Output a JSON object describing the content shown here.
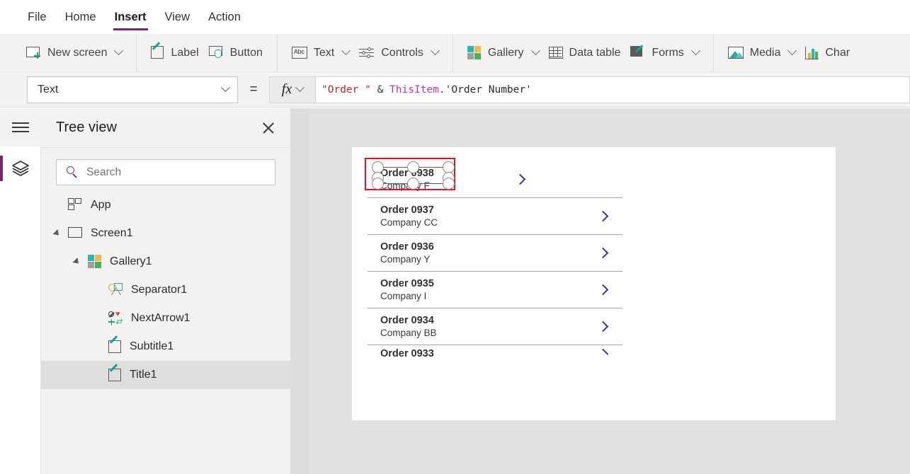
{
  "menu": {
    "items": [
      {
        "label": "File",
        "active": false
      },
      {
        "label": "Home",
        "active": false
      },
      {
        "label": "Insert",
        "active": true
      },
      {
        "label": "View",
        "active": false
      },
      {
        "label": "Action",
        "active": false
      }
    ]
  },
  "ribbon": {
    "items": [
      {
        "label": "New screen",
        "icon": "new-screen-icon",
        "caret": true
      },
      {
        "label": "Label",
        "icon": "label-icon",
        "caret": false
      },
      {
        "label": "Button",
        "icon": "button-icon",
        "caret": false
      },
      {
        "label": "Text",
        "icon": "text-icon",
        "caret": true
      },
      {
        "label": "Controls",
        "icon": "controls-icon",
        "caret": true
      },
      {
        "label": "Gallery",
        "icon": "gallery-icon",
        "caret": true
      },
      {
        "label": "Data table",
        "icon": "data-table-icon",
        "caret": false
      },
      {
        "label": "Forms",
        "icon": "forms-icon",
        "caret": true
      },
      {
        "label": "Media",
        "icon": "media-icon",
        "caret": true
      },
      {
        "label": "Char",
        "icon": "charts-icon",
        "caret": false
      }
    ],
    "text_icon_glyph": "Abc"
  },
  "formula_bar": {
    "property": "Text",
    "equals": "=",
    "fx_label": "fx",
    "formula": "\"Order \" & ThisItem.'Order Number'",
    "tokens": {
      "string": "\"Order \"",
      "amp": " & ",
      "this_item": "ThisItem",
      "dot": ".",
      "property_ref": "'Order Number'"
    }
  },
  "tree_panel": {
    "title": "Tree view",
    "search_placeholder": "Search",
    "search_value": "",
    "items": [
      {
        "label": "App",
        "icon": "app-icon",
        "depth": 0,
        "expander": false,
        "selected": false
      },
      {
        "label": "Screen1",
        "icon": "screen-icon",
        "depth": 0,
        "expander": true,
        "selected": false
      },
      {
        "label": "Gallery1",
        "icon": "gallery-icon",
        "depth": 1,
        "expander": true,
        "selected": false
      },
      {
        "label": "Separator1",
        "icon": "shapes-icon",
        "depth": 2,
        "expander": false,
        "selected": false
      },
      {
        "label": "NextArrow1",
        "icon": "icon-set-icon",
        "depth": 2,
        "expander": false,
        "selected": false
      },
      {
        "label": "Subtitle1",
        "icon": "label-icon",
        "depth": 2,
        "expander": false,
        "selected": false
      },
      {
        "label": "Title1",
        "icon": "label-icon",
        "depth": 2,
        "expander": false,
        "selected": true
      }
    ]
  },
  "rail": {
    "hamburger": "hamburger-icon",
    "items": [
      {
        "icon": "layers-icon",
        "active": true
      }
    ]
  },
  "canvas": {
    "gallery_rows": [
      {
        "title": "Order 0938",
        "subtitle": "Company F",
        "selected": true,
        "clipped": false
      },
      {
        "title": "Order 0937",
        "subtitle": "Company CC",
        "selected": false,
        "clipped": false
      },
      {
        "title": "Order 0936",
        "subtitle": "Company Y",
        "selected": false,
        "clipped": false
      },
      {
        "title": "Order 0935",
        "subtitle": "Company I",
        "selected": false,
        "clipped": false
      },
      {
        "title": "Order 0934",
        "subtitle": "Company BB",
        "selected": false,
        "clipped": false
      },
      {
        "title": "Order 0933",
        "subtitle": "",
        "selected": false,
        "clipped": true
      }
    ]
  },
  "colors": {
    "accent_purple": "#742774",
    "selection_red": "#e81123",
    "chevron_blue": "#30398f",
    "ribbon_bg": "#f3f2f1",
    "canvas_bg": "#e1e1e1"
  }
}
